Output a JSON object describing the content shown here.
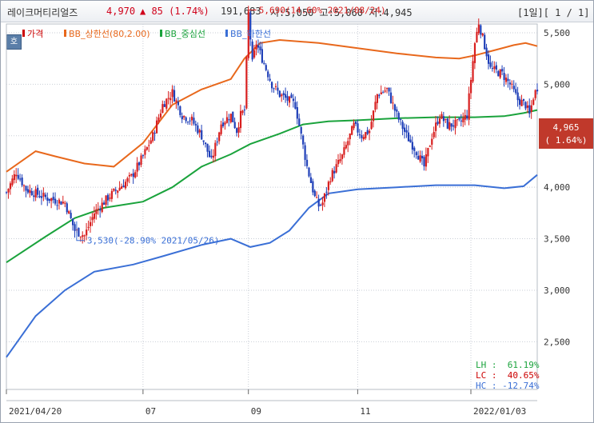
{
  "header": {
    "name": "레이크머티리얼즈",
    "price": "4,970",
    "change": "▲ 85 (1.74%)",
    "volume": "191,683",
    "ohlc": "시:5,050 고:5,060 저:4,945",
    "page": "[1일][ 1 / 1]"
  },
  "badge": "호",
  "legend": [
    {
      "label": "가격",
      "color": "#cc0000"
    },
    {
      "label": "BB_상한선(80,2.00)",
      "color": "#e8681c"
    },
    {
      "label": "BB_중심선",
      "color": "#1aa33c"
    },
    {
      "label": "BB_하한선",
      "color": "#3a6fd6"
    }
  ],
  "price_tag": {
    "value": "4,965",
    "change": "( 1.64%)",
    "color": "#c0392b"
  },
  "annotations": {
    "high": "5,690(14.60% 2021/08/24)",
    "low": "3,530(-28.90% 2021/05/26)"
  },
  "indicators": {
    "lh": "LH :  61.19%",
    "lc": "LC :  40.65%",
    "hc": "HC : -12.74%"
  },
  "chart_data": {
    "type": "line",
    "title": "",
    "x": [
      "2021/04/20",
      "07",
      "09",
      "11",
      "2022/01/03"
    ],
    "yticks": [
      "5,500",
      "5,000",
      "4,500",
      "4,000",
      "3,500",
      "3,000",
      "2,500"
    ],
    "ylim": [
      2300,
      5800
    ],
    "grid": true,
    "series": [
      {
        "name": "가격",
        "color": "#cc0000",
        "points": [
          [
            0,
            3950
          ],
          [
            5,
            4150
          ],
          [
            10,
            3980
          ],
          [
            20,
            3900
          ],
          [
            30,
            3850
          ],
          [
            35,
            3580
          ],
          [
            40,
            3530
          ],
          [
            45,
            3750
          ],
          [
            52,
            3900
          ],
          [
            58,
            4000
          ],
          [
            64,
            4100
          ],
          [
            70,
            4300
          ],
          [
            75,
            4500
          ],
          [
            80,
            4800
          ],
          [
            85,
            4920
          ],
          [
            90,
            4700
          ],
          [
            95,
            4650
          ],
          [
            100,
            4500
          ],
          [
            105,
            4250
          ],
          [
            110,
            4620
          ],
          [
            115,
            4700
          ],
          [
            118,
            4550
          ],
          [
            120,
            4700
          ],
          [
            122,
            4750
          ],
          [
            124,
            5690
          ],
          [
            126,
            5200
          ],
          [
            128,
            5400
          ],
          [
            132,
            5200
          ],
          [
            136,
            5000
          ],
          [
            140,
            4900
          ],
          [
            144,
            4850
          ],
          [
            148,
            4800
          ],
          [
            150,
            4600
          ],
          [
            154,
            4200
          ],
          [
            158,
            3900
          ],
          [
            160,
            3820
          ],
          [
            162,
            3850
          ],
          [
            166,
            4100
          ],
          [
            172,
            4300
          ],
          [
            178,
            4600
          ],
          [
            182,
            4500
          ],
          [
            186,
            4550
          ],
          [
            190,
            4900
          ],
          [
            195,
            4950
          ],
          [
            200,
            4700
          ],
          [
            205,
            4500
          ],
          [
            210,
            4350
          ],
          [
            214,
            4200
          ],
          [
            218,
            4500
          ],
          [
            222,
            4700
          ],
          [
            226,
            4600
          ],
          [
            232,
            4620
          ],
          [
            236,
            4700
          ],
          [
            240,
            5400
          ],
          [
            242,
            5600
          ],
          [
            244,
            5450
          ],
          [
            248,
            5150
          ],
          [
            254,
            5100
          ],
          [
            258,
            5000
          ],
          [
            262,
            4850
          ],
          [
            266,
            4800
          ],
          [
            268,
            4700
          ],
          [
            270,
            4880
          ],
          [
            272,
            4970
          ]
        ]
      },
      {
        "name": "BB_상한선(80,2.00)",
        "color": "#e8681c",
        "points": [
          [
            0,
            4150
          ],
          [
            15,
            4350
          ],
          [
            25,
            4300
          ],
          [
            40,
            4230
          ],
          [
            55,
            4200
          ],
          [
            70,
            4430
          ],
          [
            85,
            4800
          ],
          [
            100,
            4950
          ],
          [
            115,
            5050
          ],
          [
            122,
            5250
          ],
          [
            130,
            5400
          ],
          [
            140,
            5430
          ],
          [
            160,
            5400
          ],
          [
            180,
            5350
          ],
          [
            200,
            5300
          ],
          [
            220,
            5260
          ],
          [
            232,
            5250
          ],
          [
            240,
            5280
          ],
          [
            250,
            5330
          ],
          [
            260,
            5380
          ],
          [
            266,
            5400
          ],
          [
            272,
            5370
          ]
        ]
      },
      {
        "name": "BB_중심선",
        "color": "#1aa33c",
        "points": [
          [
            0,
            3270
          ],
          [
            20,
            3520
          ],
          [
            35,
            3700
          ],
          [
            50,
            3800
          ],
          [
            70,
            3860
          ],
          [
            85,
            4000
          ],
          [
            100,
            4200
          ],
          [
            115,
            4320
          ],
          [
            125,
            4420
          ],
          [
            140,
            4520
          ],
          [
            152,
            4610
          ],
          [
            165,
            4640
          ],
          [
            180,
            4650
          ],
          [
            200,
            4670
          ],
          [
            220,
            4680
          ],
          [
            240,
            4680
          ],
          [
            255,
            4690
          ],
          [
            265,
            4720
          ],
          [
            272,
            4750
          ]
        ]
      },
      {
        "name": "BB_하한선",
        "color": "#3a6fd6",
        "points": [
          [
            0,
            2350
          ],
          [
            15,
            2750
          ],
          [
            30,
            3000
          ],
          [
            45,
            3180
          ],
          [
            65,
            3250
          ],
          [
            80,
            3330
          ],
          [
            100,
            3440
          ],
          [
            115,
            3500
          ],
          [
            125,
            3420
          ],
          [
            135,
            3460
          ],
          [
            145,
            3580
          ],
          [
            155,
            3800
          ],
          [
            165,
            3940
          ],
          [
            180,
            3980
          ],
          [
            200,
            4000
          ],
          [
            220,
            4020
          ],
          [
            240,
            4020
          ],
          [
            255,
            3990
          ],
          [
            265,
            4010
          ],
          [
            272,
            4120
          ]
        ]
      }
    ]
  }
}
